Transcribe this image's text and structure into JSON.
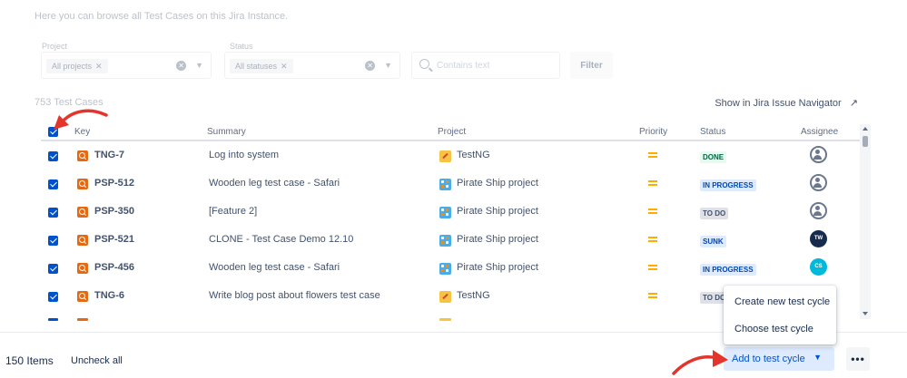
{
  "intro_text": "Here you can browse all Test Cases on this Jira Instance.",
  "filters": {
    "project_label": "Project",
    "project_chip": "All projects",
    "status_label": "Status",
    "status_chip": "All statuses",
    "search_placeholder": "Contains text",
    "filter_button": "Filter"
  },
  "results": {
    "count_label": "753 Test Cases",
    "issue_navigator_link": "Show in Jira Issue Navigator",
    "issue_navigator_icon": "external-arrow-icon"
  },
  "table": {
    "headers": {
      "key": "Key",
      "summary": "Summary",
      "project": "Project",
      "priority": "Priority",
      "status": "Status",
      "assignee": "Assignee"
    },
    "rows": [
      {
        "key": "TNG-7",
        "summary": "Log into system",
        "project": "TestNG",
        "priority": "medium",
        "status": "DONE",
        "assignee": "default-avatar"
      },
      {
        "key": "PSP-512",
        "summary": "Wooden leg test case - Safari",
        "project": "Pirate Ship project",
        "priority": "medium",
        "status": "IN PROGRESS",
        "assignee": "default-avatar"
      },
      {
        "key": "PSP-350",
        "summary": "[Feature 2]",
        "project": "Pirate Ship project",
        "priority": "medium",
        "status": "TO DO",
        "assignee": "default-avatar"
      },
      {
        "key": "PSP-521",
        "summary": "CLONE - Test Case Demo 12.10",
        "project": "Pirate Ship project",
        "priority": "medium",
        "status": "SUNK",
        "assignee": "TW"
      },
      {
        "key": "PSP-456",
        "summary": "Wooden leg test case - Safari",
        "project": "Pirate Ship project",
        "priority": "medium",
        "status": "IN PROGRESS",
        "assignee": "CS"
      },
      {
        "key": "TNG-6",
        "summary": "Write blog post about flowers test case",
        "project": "TestNG",
        "priority": "medium",
        "status": "TO DO",
        "assignee": ""
      }
    ]
  },
  "footer": {
    "items_count": "150 Items",
    "uncheck_all": "Uncheck all",
    "add_button": "Add to test cycle",
    "more_button": "•••"
  },
  "dropdown": {
    "items": [
      "Create new test cycle",
      "Choose test cycle"
    ]
  },
  "colors": {
    "accent": "#0052cc",
    "annotation_arrow": "#e5342c",
    "priority_medium": "#ffab00"
  }
}
